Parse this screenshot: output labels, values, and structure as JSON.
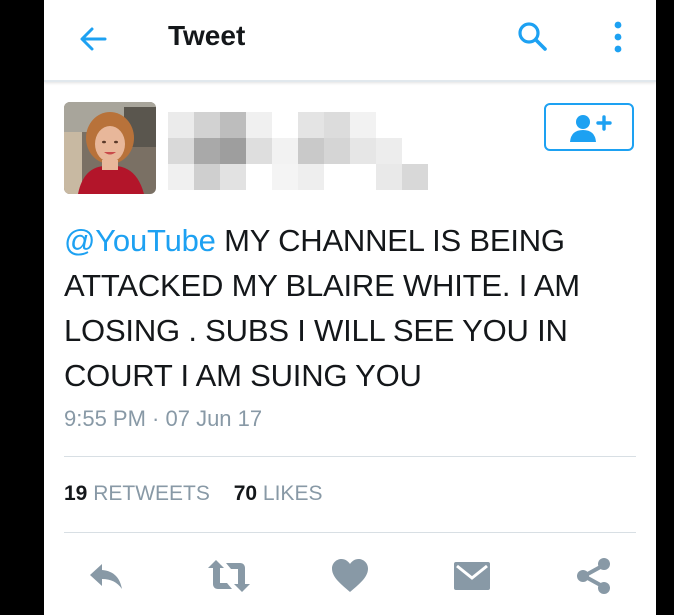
{
  "header": {
    "title": "Tweet",
    "icons": [
      "back-arrow-icon",
      "search-icon",
      "more-vertical-icon"
    ]
  },
  "tweet": {
    "mention": "@YouTube",
    "text": " MY CHANNEL IS BEING ATTACKED MY BLAIRE WHITE.  I AM LOSING .  SUBS  I WILL SEE YOU IN COURT I AM SUING YOU",
    "timestamp": "9:55 PM · 07 Jun 17",
    "retweets_count": "19",
    "retweets_label": "RETWEETS",
    "likes_count": "70",
    "likes_label": "LIKES"
  },
  "actions": [
    "reply-icon",
    "retweet-icon",
    "like-icon",
    "direct-message-icon",
    "share-icon"
  ],
  "colors": {
    "accent": "#1da1f2",
    "action_icon": "#8899a6",
    "text": "#14171a",
    "muted": "#8899a6"
  }
}
